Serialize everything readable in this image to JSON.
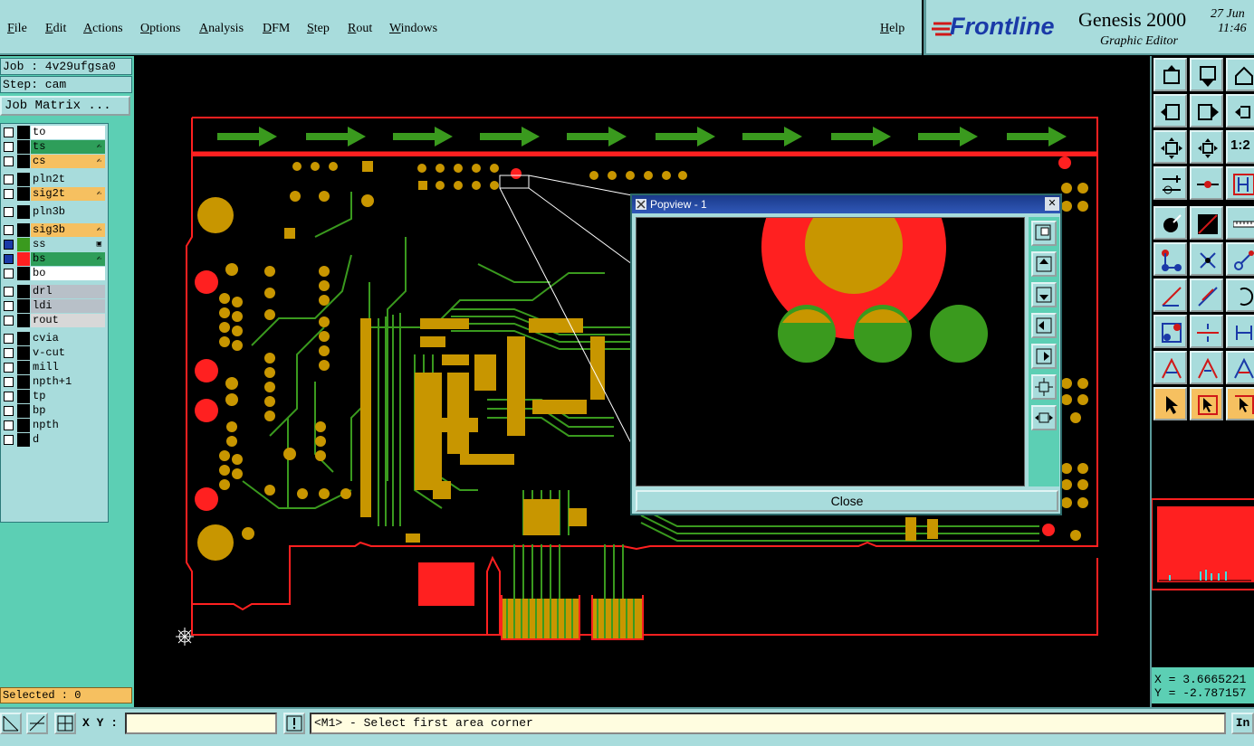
{
  "menu": {
    "items": [
      "File",
      "Edit",
      "Actions",
      "Options",
      "Analysis",
      "DFM",
      "Step",
      "Rout",
      "Windows"
    ],
    "help": "Help"
  },
  "brand": {
    "logo": "Frontline",
    "product": "Genesis 2000",
    "subtitle": "Graphic Editor",
    "date": "27 Jun",
    "time": "11:46"
  },
  "job": {
    "job_label": "Job : 4v29ufgsa0",
    "step_label": "Step: cam",
    "matrix_button": "Job Matrix ..."
  },
  "layers": [
    {
      "name": "to",
      "color": "#ffffff",
      "active": false,
      "mark": ""
    },
    {
      "name": "ts",
      "color": "#2e9e5a",
      "active": false,
      "mark": "✍"
    },
    {
      "name": "cs",
      "color": "#f6c060",
      "active": false,
      "mark": "✍"
    },
    {
      "name": "pln2t",
      "color": "#a8dcdc",
      "active": false,
      "mark": ""
    },
    {
      "name": "sig2t",
      "color": "#f6c060",
      "active": false,
      "mark": "✍"
    },
    {
      "name": "pln3b",
      "color": "#a8dcdc",
      "active": false,
      "mark": ""
    },
    {
      "name": "sig3b",
      "color": "#f6c060",
      "active": false,
      "mark": "✍"
    },
    {
      "name": "ss",
      "color": "#a8dcdc",
      "active": true,
      "mark": "▣"
    },
    {
      "name": "bs",
      "color": "#2e9e5a",
      "active": true,
      "mark": "✍"
    },
    {
      "name": "bo",
      "color": "#ffffff",
      "active": false,
      "mark": ""
    },
    {
      "name": "drl",
      "color": "#b8c0c8",
      "active": false,
      "mark": ""
    },
    {
      "name": "ldi",
      "color": "#b8c0c8",
      "active": false,
      "mark": ""
    },
    {
      "name": "rout",
      "color": "#d8d8d8",
      "active": false,
      "mark": ""
    },
    {
      "name": "cvia",
      "color": "#a8dcdc",
      "active": false,
      "mark": ""
    },
    {
      "name": "v-cut",
      "color": "#a8dcdc",
      "active": false,
      "mark": ""
    },
    {
      "name": "mill",
      "color": "#a8dcdc",
      "active": false,
      "mark": ""
    },
    {
      "name": "npth+1",
      "color": "#a8dcdc",
      "active": false,
      "mark": ""
    },
    {
      "name": "tp",
      "color": "#a8dcdc",
      "active": false,
      "mark": ""
    },
    {
      "name": "bp",
      "color": "#a8dcdc",
      "active": false,
      "mark": ""
    },
    {
      "name": "npth",
      "color": "#a8dcdc",
      "active": false,
      "mark": ""
    },
    {
      "name": "d",
      "color": "#a8dcdc",
      "active": false,
      "mark": ""
    }
  ],
  "selected": "Selected : 0",
  "popview": {
    "title": "Popview - 1",
    "close_label": "Close",
    "close_x": "✕"
  },
  "coords": {
    "x": "X = 3.6665221",
    "y": "Y = -2.787157"
  },
  "status": {
    "xy_label": "X Y :",
    "message": "<M1> - Select first area corner",
    "info_button": "In"
  },
  "colors": {
    "accent": "#a8dcdc",
    "panel": "#5ccfb4",
    "pad": "#c89600",
    "trace": "#3a9a1e",
    "outline": "#ff2020"
  }
}
